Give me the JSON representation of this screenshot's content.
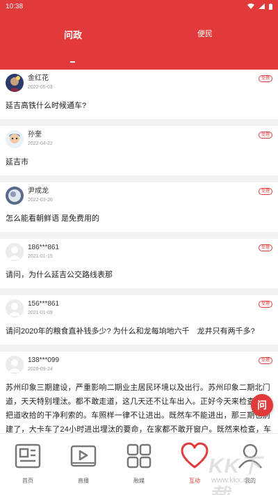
{
  "status_bar": {
    "time": "10:38"
  },
  "tabs": [
    {
      "label": "问政",
      "active": true
    },
    {
      "label": "便民",
      "active": false
    }
  ],
  "questions": [
    {
      "name": "金红花",
      "date": "2022-05-03",
      "badge": "受理",
      "text": "延吉高铁什么时候通车?"
    },
    {
      "name": "孙奎",
      "date": "2022-04-22",
      "badge": "受理",
      "text": "延吉市"
    },
    {
      "name": "尹成龙",
      "date": "2022-03-26",
      "badge": "受理",
      "text": "怎么能看朝鲜语 是免费用的"
    },
    {
      "name": "186***861",
      "date": "2021-01-15",
      "badge": "受理",
      "text": "请问，为什么延吉公交路线表那"
    },
    {
      "name": "156***861",
      "date": "2021-01-09",
      "badge": "受理",
      "text": "请问2020年的粮食直补钱多少? 为什么和龙每垧地六千　龙井只有两千多?"
    },
    {
      "name": "138***099",
      "date": "2020-09-24",
      "badge": "受理",
      "text": "苏州印象三期建设，严重影响二期业主居民环境以及出行。苏州印象二期北门道，天天特别埋汰。都不敢走道，这几天还不让车出入。正好今天来检查了，把道收拾的干净利索的。车照样一律不让进出。既然车不能进出，那三期也别建了，大卡车了24小时进出埋汰的要命，在家都不敢开窗户。既然来检查，车不让进，就不能"
    }
  ],
  "fab": {
    "label": "问"
  },
  "nav": [
    {
      "label": "首页",
      "icon": "news-icon",
      "active": false
    },
    {
      "label": "直播",
      "icon": "video-icon",
      "active": false
    },
    {
      "label": "融媒",
      "icon": "grid-icon",
      "active": false
    },
    {
      "label": "互动",
      "icon": "heart-icon",
      "active": true
    },
    {
      "label": "我的",
      "icon": "person-icon",
      "active": false
    }
  ],
  "watermark": {
    "big": "KK下载",
    "small": "www.kkx.net"
  },
  "colors": {
    "accent": "#e23a3a"
  }
}
